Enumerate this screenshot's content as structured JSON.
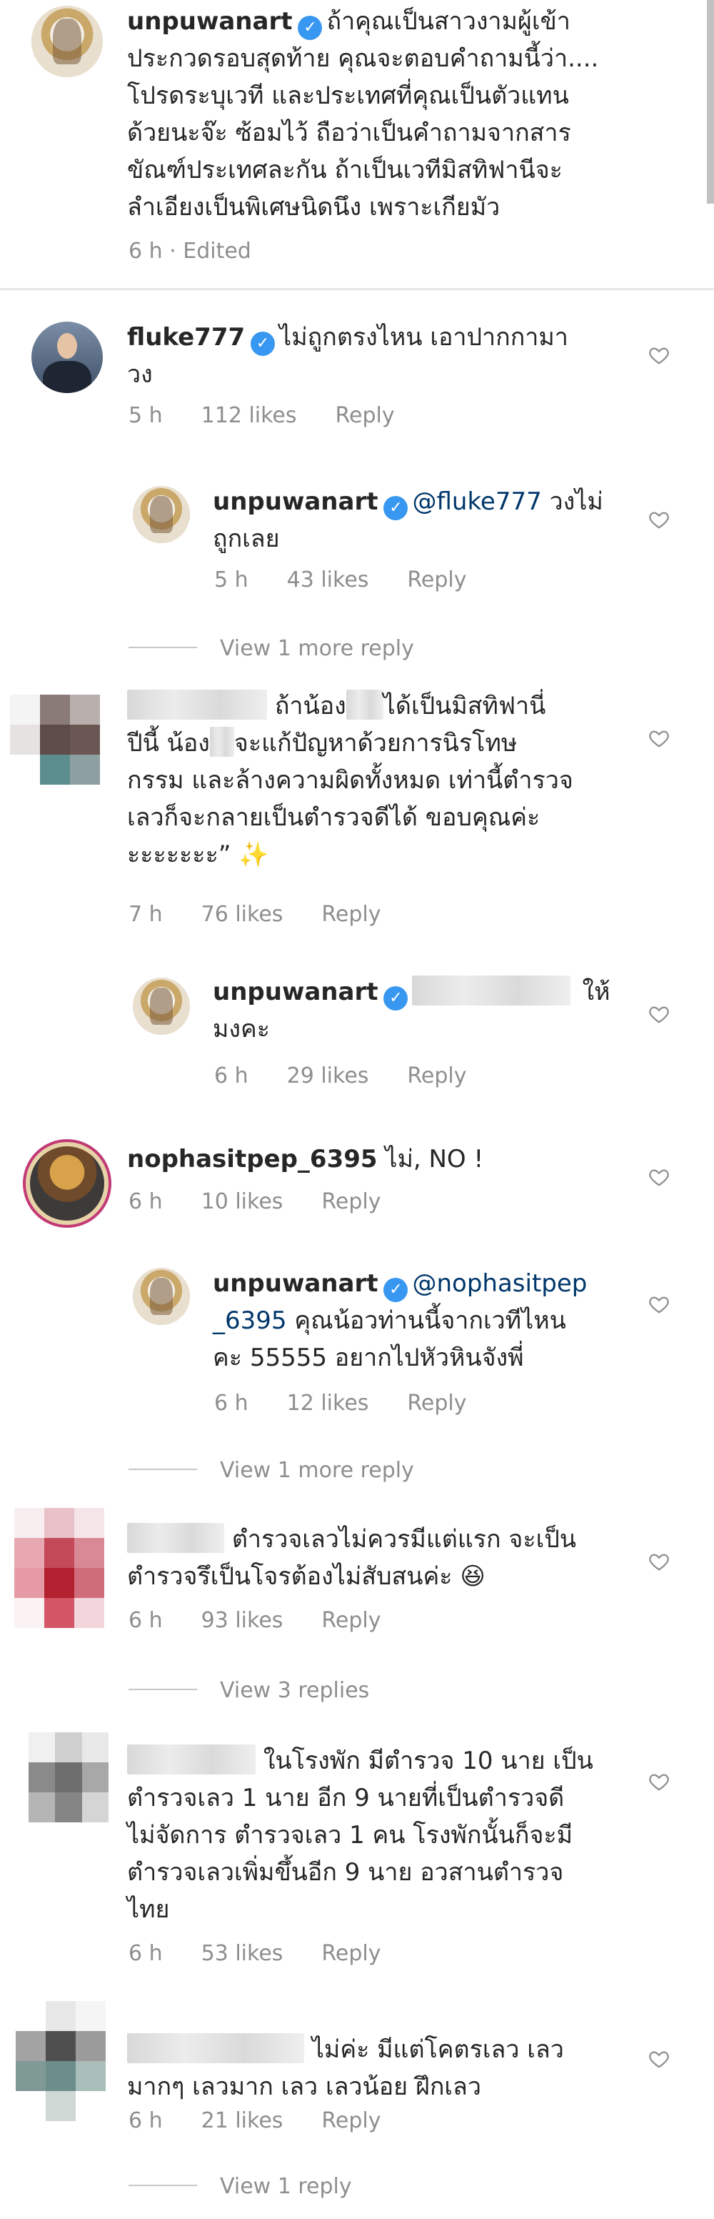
{
  "icons": {
    "verified": "verified-badge-icon",
    "like": "heart-outline-icon"
  },
  "colors": {
    "verified": "#3897f0",
    "mention": "#00376b",
    "meta": "#8e8e8e"
  },
  "caption": {
    "username": "unpuwanart",
    "lines": [
      "ถ้าคุณเป็นสาวงามผู้เข้า",
      "ประกวดรอบสุดท้าย คุณจะตอบคำถามนี้ว่า....",
      "โปรดระบุเวที และประเทศที่คุณเป็นตัวแทน",
      "ด้วยนะจ๊ะ  ซ้อมไว้ ถือว่าเป็นคำถามจากสาร",
      "ขัณฑ์ประเทศละกัน ถ้าเป็นเวทีมิสทิฟานีจะ",
      "ลำเอียงเป็นพิเศษนิดนึง เพราะเกียมัว"
    ],
    "time": "6 h · Edited"
  },
  "c1": {
    "username": "fluke777",
    "line1": "ไม่ถูกตรงไหน เอาปากกามา",
    "line2": "วง",
    "time": "5 h",
    "likes": "112 likes",
    "reply": "Reply"
  },
  "r1": {
    "username": "unpuwanart",
    "mention": "@fluke777",
    "line1_tail": " วงไม่",
    "line2": "ถูกเลย",
    "time": "5 h",
    "likes": "43 likes",
    "reply": "Reply"
  },
  "view1": "View 1 more reply",
  "c2": {
    "line1_a": "ถ้าน้อง",
    "line1_b": "ได้เป็นมิสทิฟานี่",
    "line2_a": "ปีนี้ น้อง",
    "line2_b": "จะแก้ปัญหาด้วยการนิรโทษ",
    "line3": "กรรม และล้างความผิดทั้งหมด เท่านี้ตำรวจ",
    "line4": "เลวก็จะกลายเป็นตำรวจดีได้ ขอบคุณค่ะ",
    "line5": "ะะะะะะะ”",
    "sparkle": "✨",
    "time": "7 h",
    "likes": "76 likes",
    "reply": "Reply"
  },
  "r2": {
    "username": "unpuwanart",
    "line1_tail": "ให้",
    "line2": "มงคะ",
    "time": "6 h",
    "likes": "29 likes",
    "reply": "Reply"
  },
  "c3": {
    "username": "nophasitpep_6395",
    "text": " ไม่, NO !",
    "time": "6 h",
    "likes": "10 likes",
    "reply": "Reply"
  },
  "r3": {
    "username": "unpuwanart",
    "mention_a": "@nophasitpep",
    "mention_b": "_6395",
    "line2_tail": " คุณน้อวท่านนี้จากเวทีไหน",
    "line3": "คะ 55555 อยากไปหัวหินจังพี่",
    "time": "6 h",
    "likes": "12 likes",
    "reply": "Reply"
  },
  "view2": "View 1 more reply",
  "c4": {
    "line1": "ตำรวจเลวไม่ควรมีแต่แรก จะเป็น",
    "line2": "ตำรวจรึเป็นโจรต้องไม่สับสนค่ะ",
    "emoji": "😆",
    "time": "6 h",
    "likes": "93 likes",
    "reply": "Reply"
  },
  "view3": "View 3 replies",
  "c5": {
    "line1": "ในโรงพัก มีตำรวจ 10 นาย เป็น",
    "line2": "ตำรวจเลว 1 นาย อีก 9 นายที่เป็นตำรวจดี",
    "line3": "ไม่จัดการ ตำรวจเลว 1 คน โรงพักนั้นก็จะมี",
    "line4": "ตำรวจเลวเพิ่มขึ้นอีก 9 นาย อวสานตำรวจ",
    "line5": "ไทย",
    "time": "6 h",
    "likes": "53 likes",
    "reply": "Reply"
  },
  "c6": {
    "line1": "ไม่ค่ะ มีแต่โคตรเลว เลว",
    "line2": "มากๆ เลวมาก  เลว เลวน้อย ฝึกเลว",
    "time": "6 h",
    "likes": "21 likes",
    "reply": "Reply"
  },
  "view4": "View 1 reply"
}
